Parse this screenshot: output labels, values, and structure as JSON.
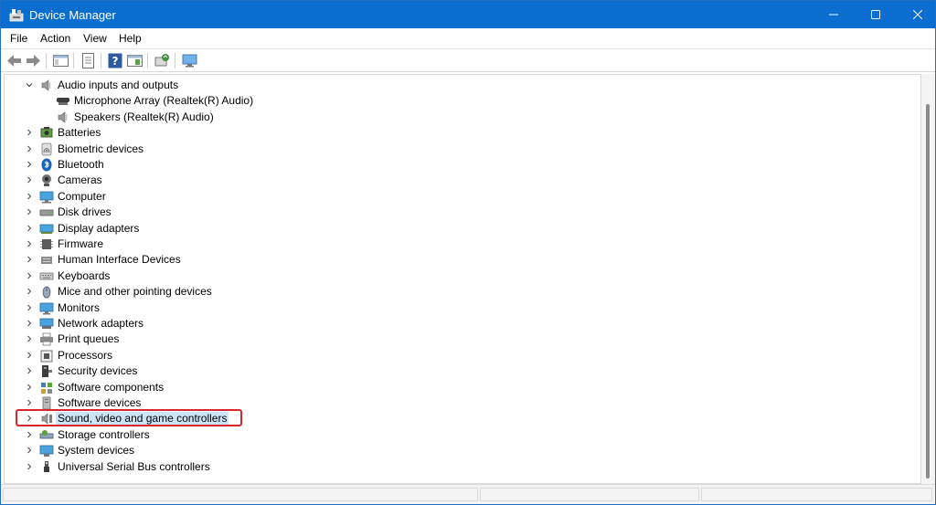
{
  "window": {
    "title": "Device Manager",
    "minimize_glyph": "—",
    "close_glyph": "✕"
  },
  "menu": {
    "items": [
      {
        "label": "File"
      },
      {
        "label": "Action"
      },
      {
        "label": "View"
      },
      {
        "label": "Help"
      }
    ]
  },
  "toolbar": {
    "buttons": [
      "back-icon",
      "forward-icon",
      "show-hide-console-tree-icon",
      "properties-icon",
      "help-icon",
      "action-pane-icon",
      "update-driver-icon",
      "scan-hardware-icon"
    ]
  },
  "tree": {
    "nodes": [
      {
        "label": "Audio inputs and outputs",
        "expanded": true,
        "icon": "speaker-icon"
      },
      {
        "label": "Microphone Array (Realtek(R) Audio)",
        "child": true,
        "icon": "microphone-icon"
      },
      {
        "label": "Speakers (Realtek(R) Audio)",
        "child": true,
        "icon": "speaker-icon"
      },
      {
        "label": "Batteries",
        "icon": "battery-icon"
      },
      {
        "label": "Biometric devices",
        "icon": "fingerprint-icon"
      },
      {
        "label": "Bluetooth",
        "icon": "bluetooth-icon"
      },
      {
        "label": "Cameras",
        "icon": "camera-icon"
      },
      {
        "label": "Computer",
        "icon": "computer-icon"
      },
      {
        "label": "Disk drives",
        "icon": "disk-drive-icon"
      },
      {
        "label": "Display adapters",
        "icon": "display-adapter-icon"
      },
      {
        "label": "Firmware",
        "icon": "firmware-icon"
      },
      {
        "label": "Human Interface Devices",
        "icon": "hid-icon"
      },
      {
        "label": "Keyboards",
        "icon": "keyboard-icon"
      },
      {
        "label": "Mice and other pointing devices",
        "icon": "mouse-icon"
      },
      {
        "label": "Monitors",
        "icon": "monitor-icon"
      },
      {
        "label": "Network adapters",
        "icon": "network-adapter-icon"
      },
      {
        "label": "Print queues",
        "icon": "printer-icon"
      },
      {
        "label": "Processors",
        "icon": "processor-icon"
      },
      {
        "label": "Security devices",
        "icon": "security-device-icon"
      },
      {
        "label": "Software components",
        "icon": "software-component-icon"
      },
      {
        "label": "Software devices",
        "icon": "software-device-icon"
      },
      {
        "label": "Sound, video and game controllers",
        "icon": "sound-controller-icon",
        "selected": true
      },
      {
        "label": "Storage controllers",
        "icon": "storage-controller-icon"
      },
      {
        "label": "System devices",
        "icon": "system-device-icon"
      },
      {
        "label": "Universal Serial Bus controllers",
        "icon": "usb-icon"
      }
    ]
  },
  "colors": {
    "titlebar": "#0a6ed1",
    "selection": "#cce4f7",
    "highlight_outline": "#d8262b"
  }
}
